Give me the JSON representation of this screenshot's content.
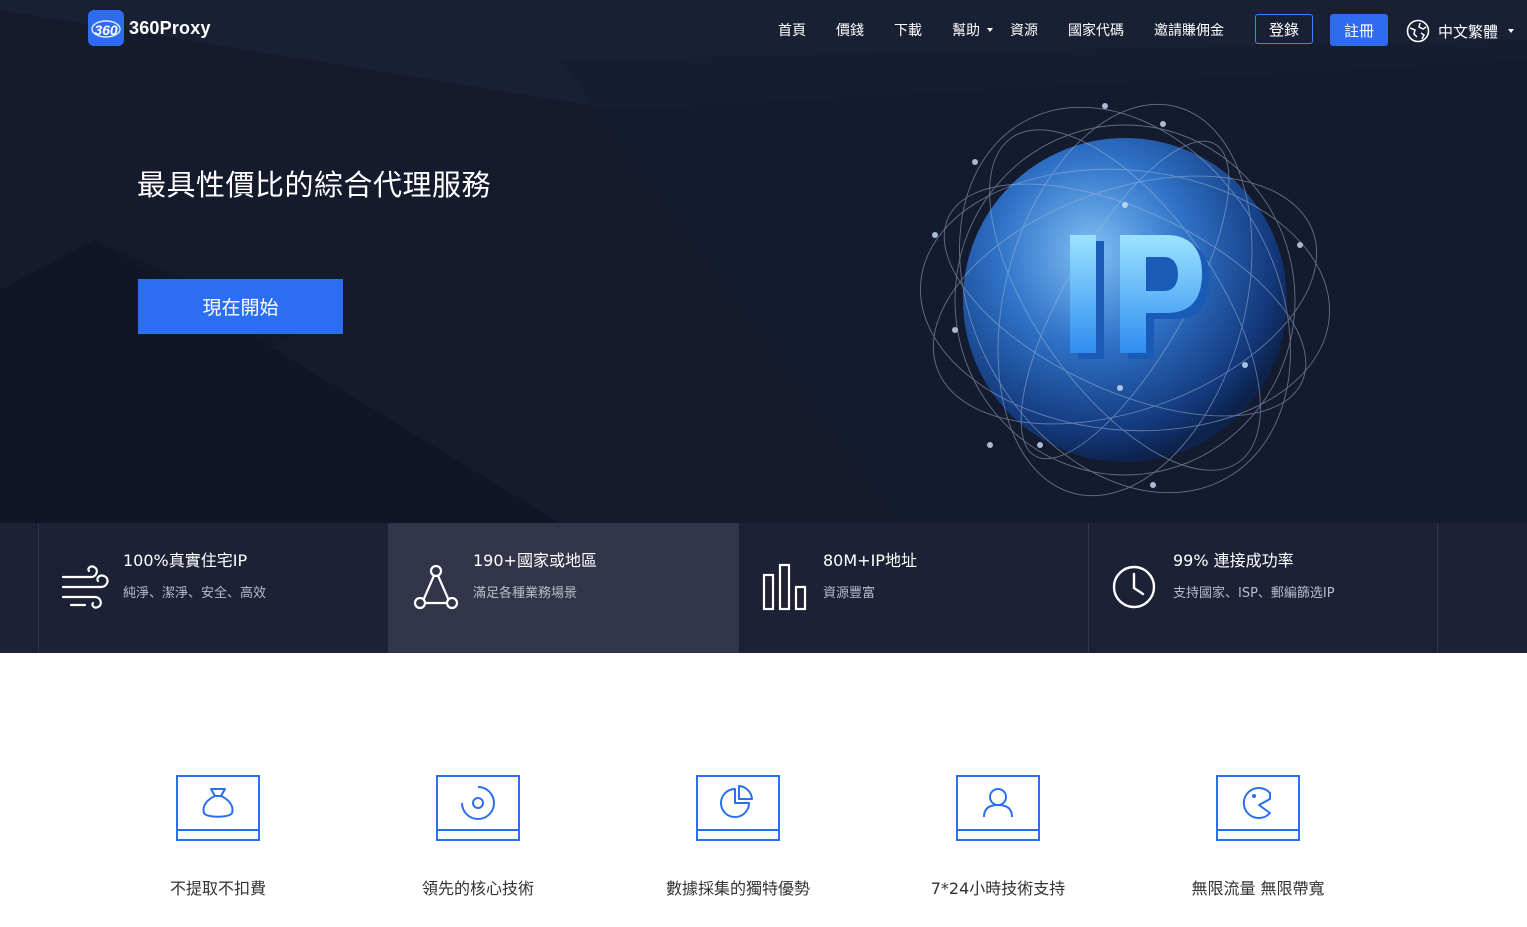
{
  "brand": {
    "name": "360Proxy",
    "mark_text": "360",
    "accent": "#2f6bf0",
    "hero_bg": "#151b2d",
    "strip_bg": "#1d2136"
  },
  "nav": {
    "items": [
      {
        "label": "首頁"
      },
      {
        "label": "價錢"
      },
      {
        "label": "下載"
      },
      {
        "label": "幫助",
        "dropdown": true
      },
      {
        "label": "資源"
      },
      {
        "label": "國家代碼"
      },
      {
        "label": "邀請賺佣金"
      }
    ],
    "login": "登錄",
    "register": "註冊",
    "language": "中文繁體"
  },
  "hero": {
    "title": "最具性價比的綜合代理服務",
    "cta": "現在開始",
    "globe_text": "IP"
  },
  "features": [
    {
      "title": "100%真實住宅IP",
      "subtitle": "純淨、潔淨、安全、高效",
      "icon": "wind-icon"
    },
    {
      "title": "190+國家或地區",
      "subtitle": "滿足各種業務場景",
      "icon": "triangle-network-icon"
    },
    {
      "title": "80M+IP地址",
      "subtitle": "資源豐富",
      "icon": "bar-chart-icon"
    },
    {
      "title": "99% 連接成功率",
      "subtitle": "支持國家、ISP、郵編篩选IP",
      "icon": "clock-icon"
    }
  ],
  "advantages": [
    {
      "label": "不提取不扣費",
      "icon": "money-bag-icon"
    },
    {
      "label": "領先的核心技術",
      "icon": "target-icon"
    },
    {
      "label": "數據採集的獨特優勢",
      "icon": "pie-chart-icon"
    },
    {
      "label": "7*24小時技術支持",
      "icon": "user-icon"
    },
    {
      "label": "無限流量 無限帶寬",
      "icon": "pacman-icon"
    }
  ]
}
